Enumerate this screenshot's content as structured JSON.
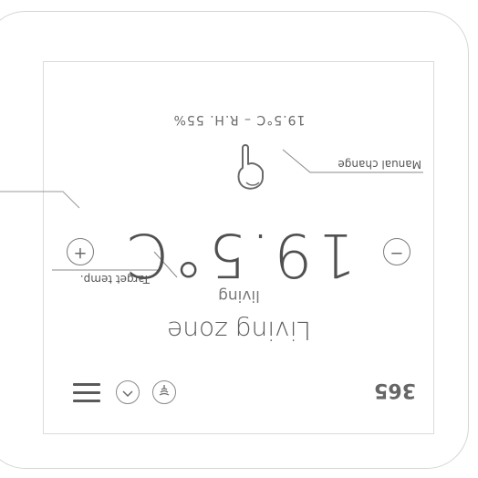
{
  "zone": {
    "name": "Living zone",
    "subtitle": "living"
  },
  "thermostat": {
    "target_temperature": "19.5°C",
    "status_line": "19.5°C – R.H. 55%",
    "increase_label": "+",
    "decrease_label": "−"
  },
  "callouts": {
    "target_label": "Target temp.",
    "manual_label": "Manual change"
  },
  "toolbar": {
    "menu_icon": "hamburger-menu-icon",
    "schedule_icon": "clock-schedule-icon",
    "boost_icon": "heat-waves-icon"
  },
  "brand": {
    "logo_text": "365",
    "logo_color": "#666666"
  },
  "colors": {
    "text": "#5e5e5e",
    "border": "#d6d6d6"
  }
}
